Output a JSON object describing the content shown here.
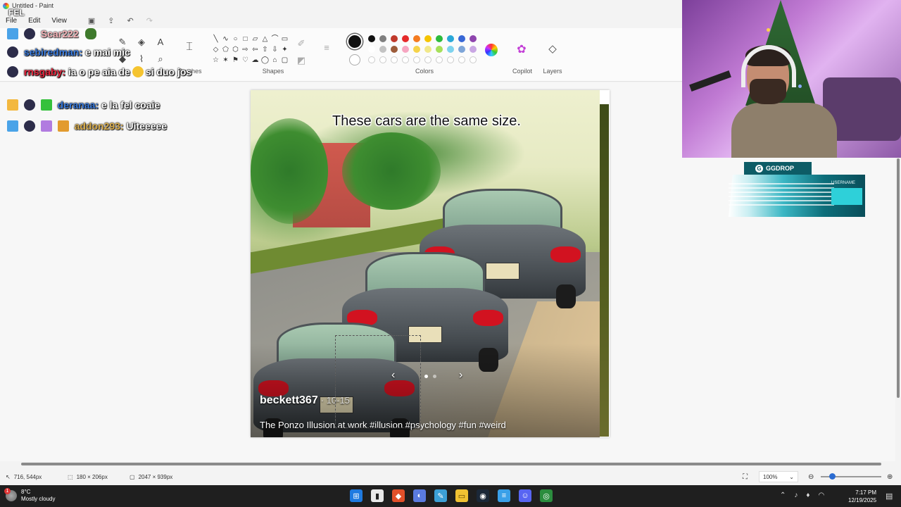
{
  "window": {
    "title": "Untitled - Paint"
  },
  "menu": {
    "file": "File",
    "edit": "Edit",
    "view": "View"
  },
  "quick_access": [
    "save-icon",
    "share-icon",
    "undo-icon",
    "redo-icon"
  ],
  "ribbon": {
    "groups": {
      "brushes": "Brushes",
      "shapes": "Shapes",
      "colors": "Colors",
      "copilot": "Copilot",
      "layers": "Layers"
    },
    "tools": [
      "pencil-icon",
      "fill-icon",
      "text-icon",
      "eraser-icon",
      "color-picker-icon",
      "magnifier-icon"
    ],
    "shape_icons": [
      "╲",
      "∿",
      "○",
      "□",
      "▱",
      "△",
      "⌒",
      "▭",
      "◇",
      "⬠",
      "⬡",
      "⇨",
      "⇦",
      "⇧",
      "⇩",
      "✦",
      "☆",
      "✶",
      "⚑",
      "♡",
      "☁",
      "◯",
      "⌂",
      "▢"
    ],
    "palette_row1": [
      "#111111",
      "#7f7f7f",
      "#c0392b",
      "#e52a2a",
      "#f47b20",
      "#f5c400",
      "#2dbb3c",
      "#2aa8d8",
      "#3867d6",
      "#8e44ad"
    ],
    "palette_row2": [
      "#ffffff",
      "#c3c3c3",
      "#9c5b3a",
      "#f6a6c1",
      "#f5d34a",
      "#f1e88a",
      "#a6e05a",
      "#7fd3ee",
      "#7ea5d8",
      "#c9a7e3"
    ]
  },
  "image_overlay": {
    "caption": "These cars are the same size.",
    "author": "beckett367",
    "date": "· 10-15",
    "description": "The Ponzo Illusion at work #illusion #psychology #fun #weird",
    "nav_prev": "‹",
    "nav_next": "›"
  },
  "chat": {
    "channel": "FEL",
    "messages": [
      {
        "user": "Scar222",
        "text": ""
      },
      {
        "user": "sebiredman:",
        "text": "e mai mic"
      },
      {
        "user": "rnsgaby:",
        "text": "ia o pe aia de",
        "text2": "si duo jos"
      },
      {
        "user": "deranaa:",
        "text": "e la fel coaie"
      },
      {
        "user": "addon293:",
        "text": "Uiteeeee"
      }
    ]
  },
  "ggdrop": {
    "label": "GGDROP",
    "tagline": "USERNAME"
  },
  "status": {
    "cursor": "716, 544px",
    "selection": "180 × 206px",
    "canvas_size": "2047 × 939px",
    "zoom": "100%"
  },
  "taskbar": {
    "weather_temp": "8°C",
    "weather_desc": "Mostly cloudy",
    "time": "7:17 PM",
    "date": "12/19/2025",
    "apps": [
      "windows-icon",
      "terminal-icon",
      "brave-icon",
      "photos-icon",
      "paint-icon",
      "explorer-icon",
      "steam-icon",
      "notepad-icon",
      "discord-icon",
      "chrome-icon"
    ]
  }
}
